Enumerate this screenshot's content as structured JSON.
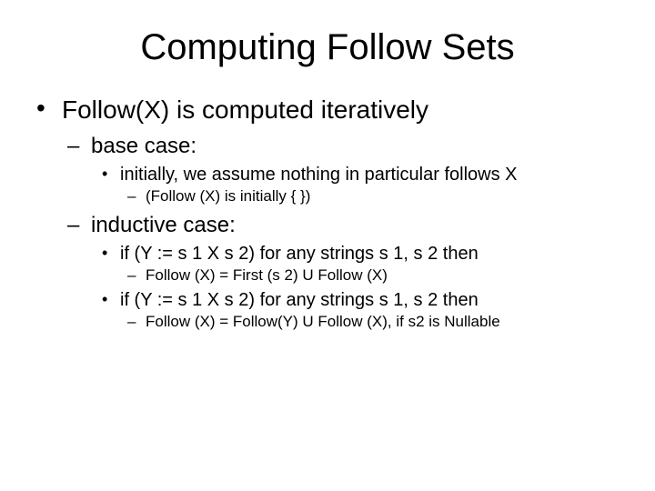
{
  "title": "Computing Follow Sets",
  "b1": "Follow(X) is computed iteratively",
  "b1a": "base case:",
  "b1a1": "initially, we assume nothing in particular follows X",
  "b1a1a": "(Follow (X) is initially { })",
  "b1b": "inductive case:",
  "b1b1": "if (Y := s 1 X s 2) for any strings s 1, s 2 then",
  "b1b1a": "Follow (X) = First (s 2) U Follow (X)",
  "b1b2": "if (Y := s 1 X s 2) for any strings s 1, s 2 then",
  "b1b2a": "Follow (X) = Follow(Y) U Follow (X),  if s2 is Nullable"
}
